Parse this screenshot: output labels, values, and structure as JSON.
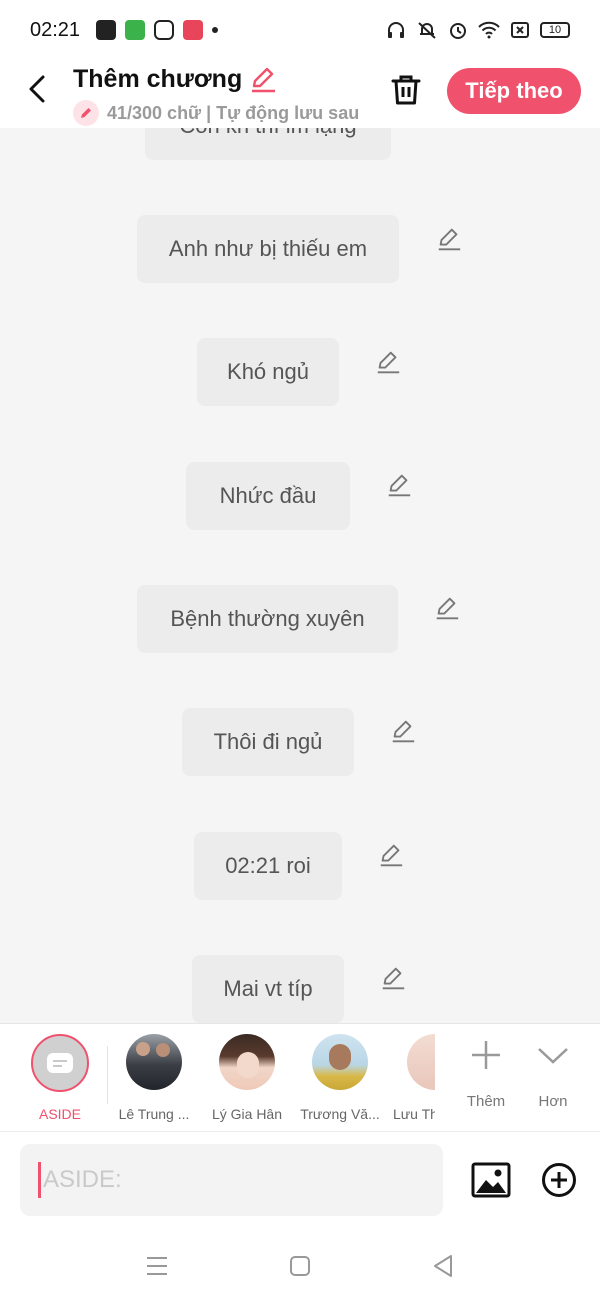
{
  "status_bar": {
    "time": "02:21",
    "battery": "10"
  },
  "header": {
    "title": "Thêm chương",
    "subtitle": "41/300 chữ | Tự động lưu sau",
    "next_label": "Tiếp theo"
  },
  "messages": [
    {
      "text": "Con kh thì im lặng"
    },
    {
      "text": "Anh như bị thiếu em"
    },
    {
      "text": "Khó ngủ"
    },
    {
      "text": "Nhức đầu"
    },
    {
      "text": "Bệnh thường xuyên"
    },
    {
      "text": "Thôi đi ngủ"
    },
    {
      "text": "02:21 roi"
    },
    {
      "text": "Mai vt típ"
    }
  ],
  "characters": [
    {
      "name": "ASIDE"
    },
    {
      "name": "Lê Trung ..."
    },
    {
      "name": "Lý Gia Hân"
    },
    {
      "name": "Trương Vă..."
    },
    {
      "name": "Lưu Th"
    }
  ],
  "tools": {
    "add_label": "Thêm",
    "more_label": "Hơn"
  },
  "composer": {
    "placeholder": "ASIDE:"
  },
  "colors": {
    "accent": "#f0516d",
    "bubble": "#ececec",
    "background": "#f5f5f5"
  }
}
